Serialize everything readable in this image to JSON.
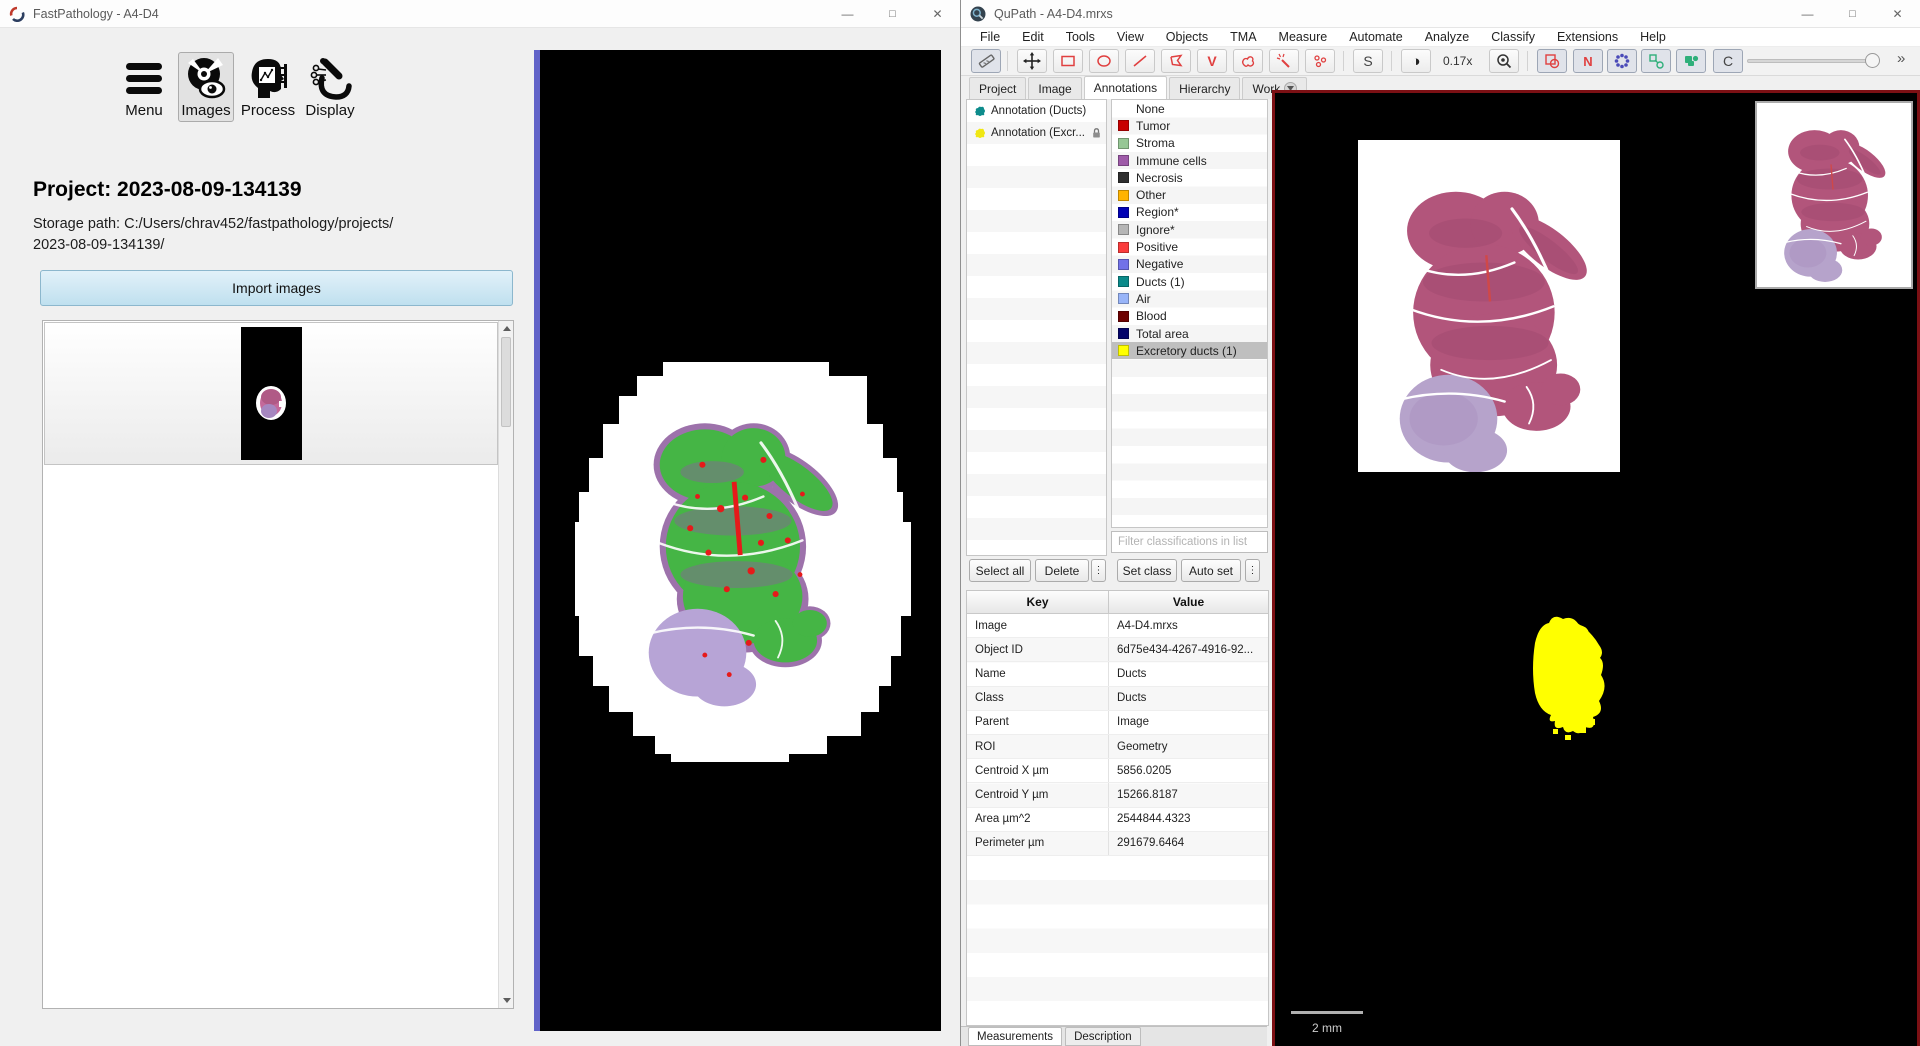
{
  "fastpathology": {
    "window_title": "FastPathology - A4-D4",
    "window_controls": {
      "minimize": "—",
      "maximize": "❐",
      "close": "✕"
    },
    "toolbar": {
      "items": [
        {
          "label": "Menu"
        },
        {
          "label": "Images",
          "selected": true
        },
        {
          "label": "Process"
        },
        {
          "label": "Display"
        }
      ]
    },
    "project_heading": "Project: 2023-08-09-134139",
    "storage_path_line1": "Storage path: C:/Users/chrav452/fastpathology/projects/",
    "storage_path_line2": "2023-08-09-134139/",
    "import_button_label": "Import images"
  },
  "qupath": {
    "window_title": "QuPath - A4-D4.mrxs",
    "window_controls": {
      "minimize": "—",
      "maximize": "❐",
      "close": "✕"
    },
    "menu": {
      "file": "File",
      "edit": "Edit",
      "tools": "Tools",
      "view": "View",
      "objects": "Objects",
      "tma": "TMA",
      "measure": "Measure",
      "automate": "Automate",
      "analyze": "Analyze",
      "classify": "Classify",
      "extensions": "Extensions",
      "help": "Help"
    },
    "toolbar": {
      "magnification": "0.17x",
      "selection_mode_label": "S",
      "names_toggle_label": "N",
      "classifier_toggle_label": "C",
      "overflow": "»"
    },
    "tabs": {
      "project": "Project",
      "image": "Image",
      "annotations": "Annotations",
      "hierarchy": "Hierarchy",
      "workflow": "Work"
    },
    "annotation_list": [
      {
        "label": "Annotation (Ducts)",
        "color": "#0e8c8c",
        "locked": false
      },
      {
        "label": "Annotation (Excr...",
        "color": "#f0e713",
        "locked": true
      }
    ],
    "classes": [
      {
        "name": "None",
        "color": ""
      },
      {
        "name": "Tumor",
        "color": "#c80000"
      },
      {
        "name": "Stroma",
        "color": "#96c795"
      },
      {
        "name": "Immune cells",
        "color": "#9e5aa8"
      },
      {
        "name": "Necrosis",
        "color": "#2f2f2f"
      },
      {
        "name": "Other",
        "color": "#ffb300"
      },
      {
        "name": "Region*",
        "color": "#0202b5"
      },
      {
        "name": "Ignore*",
        "color": "#b5b5b5"
      },
      {
        "name": "Positive",
        "color": "#fa3c3c"
      },
      {
        "name": "Negative",
        "color": "#7272e8"
      },
      {
        "name": "Ducts (1)",
        "color": "#0a8a8a"
      },
      {
        "name": "Air",
        "color": "#98b4f8"
      },
      {
        "name": "Blood",
        "color": "#6e0202"
      },
      {
        "name": "Total area",
        "color": "#04046a"
      },
      {
        "name": "Excretory ducts (1)",
        "color": "#ffff00"
      }
    ],
    "filter_placeholder": "Filter classifications in list",
    "actions": {
      "select_all": "Select all",
      "delete": "Delete",
      "more": "⋮",
      "set_class": "Set class",
      "auto_set": "Auto set"
    },
    "properties_table": {
      "key_header": "Key",
      "value_header": "Value",
      "rows": [
        {
          "key": "Image",
          "value": "A4-D4.mrxs"
        },
        {
          "key": "Object ID",
          "value": "6d75e434-4267-4916-92..."
        },
        {
          "key": "Name",
          "value": "Ducts"
        },
        {
          "key": "Class",
          "value": "Ducts"
        },
        {
          "key": "Parent",
          "value": "Image"
        },
        {
          "key": "ROI",
          "value": "Geometry"
        },
        {
          "key": "Centroid X µm",
          "value": "5856.0205"
        },
        {
          "key": "Centroid Y µm",
          "value": "15266.8187"
        },
        {
          "key": "Area µm^2",
          "value": "2544844.4323"
        },
        {
          "key": "Perimeter µm",
          "value": "291679.6464"
        }
      ]
    },
    "bottom_tabs": {
      "measurements": "Measurements",
      "description": "Description"
    },
    "viewer": {
      "scalebar_label": "2 mm"
    }
  }
}
